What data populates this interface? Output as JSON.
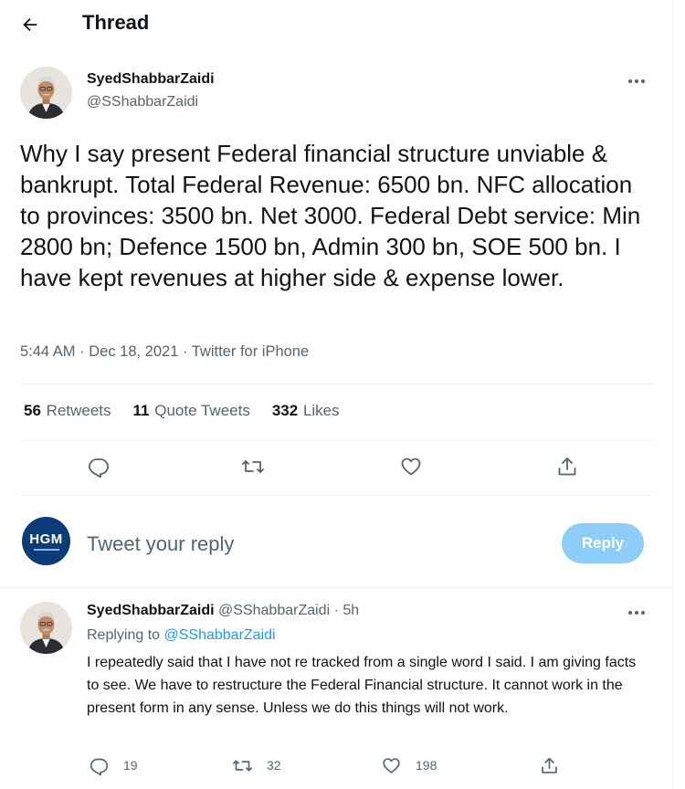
{
  "header": {
    "title": "Thread",
    "back_icon": "arrow-left-icon"
  },
  "main_tweet": {
    "author_name": "SyedShabbarZaidi",
    "author_handle": "@SShabbarZaidi",
    "text": "Why I say present Federal financial structure unviable & bankrupt. Total Federal Revenue: 6500 bn. NFC allocation to provinces: 3500 bn. Net 3000. Federal Debt service: Min 2800 bn; Defence 1500 bn, Admin 300 bn, SOE 500 bn. I have kept revenues at higher side & expense lower.",
    "time": "5:44 AM",
    "date": "Dec 18, 2021",
    "source": "Twitter for iPhone",
    "stats": {
      "retweets": "56",
      "retweets_label": "Retweets",
      "quote_tweets": "11",
      "quote_tweets_label": "Quote Tweets",
      "likes": "332",
      "likes_label": "Likes"
    },
    "actions": [
      "reply-icon",
      "retweet-icon",
      "like-icon",
      "share-icon"
    ]
  },
  "compose": {
    "avatar_text": "HGM",
    "placeholder": "Tweet your reply",
    "button_label": "Reply"
  },
  "reply_tweet": {
    "author_name": "SyedShabbarZaidi",
    "author_handle": "@SShabbarZaidi",
    "dot": "·",
    "time": "5h",
    "replying_to_label": "Replying to",
    "replying_to_handle": "@SShabbarZaidi",
    "text": "I repeatedly said that I have not re tracked from a single word I said. I am giving facts to see. We have to restructure the Federal Financial structure. It cannot work in the present form in any sense. Unless we do this things will not work.",
    "counts": {
      "replies": "19",
      "retweets": "32",
      "likes": "198"
    }
  },
  "colors": {
    "text_primary": "#0f1419",
    "text_secondary": "#536471",
    "accent": "#1d9bf0",
    "reply_button_disabled": "#8ecdf8",
    "divider": "#eff3f4",
    "compose_avatar": "#0c3b78"
  }
}
